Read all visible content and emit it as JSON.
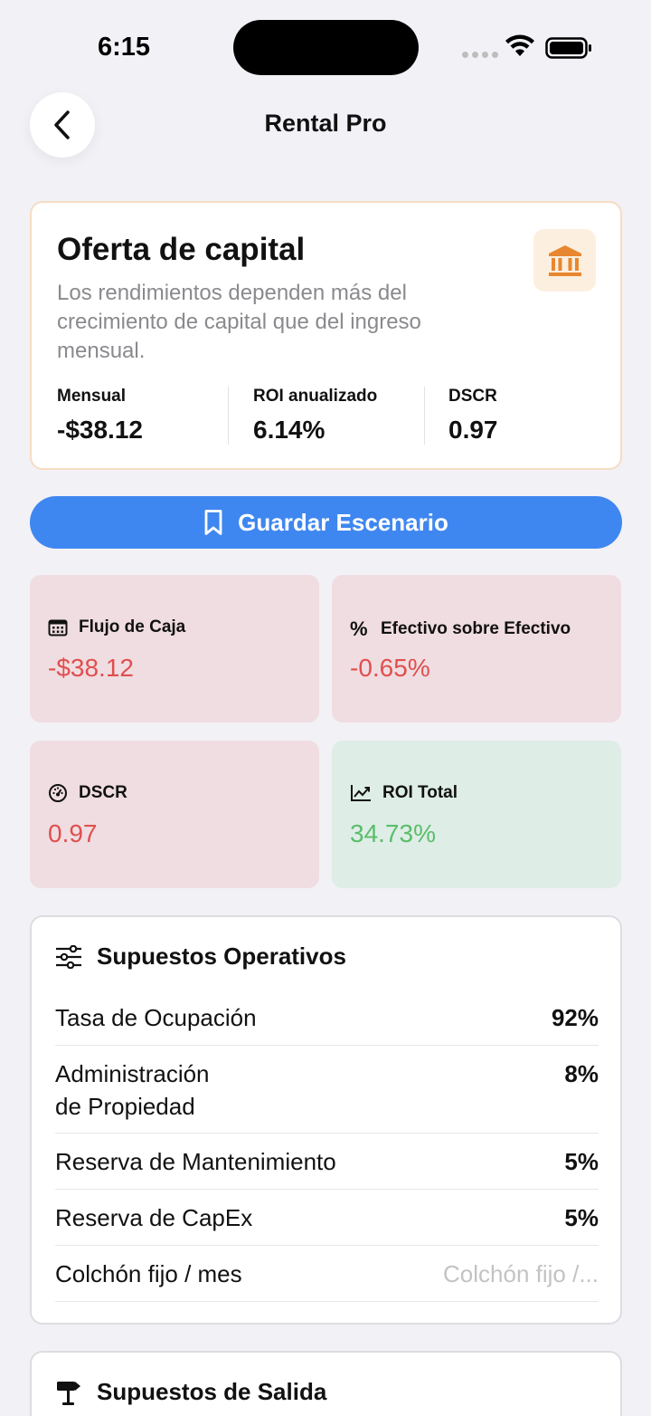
{
  "status_bar": {
    "time": "6:15"
  },
  "nav": {
    "title": "Rental Pro"
  },
  "offer": {
    "title": "Oferta de capital",
    "description": "Los rendimientos dependen más del crecimiento de capital que del ingreso mensual.",
    "icon": "bank-icon",
    "metrics": [
      {
        "label": "Mensual",
        "value": "-$38.12"
      },
      {
        "label": "ROI anualizado",
        "value": "6.14%"
      },
      {
        "label": "DSCR",
        "value": "0.97"
      }
    ]
  },
  "save_button": {
    "label": "Guardar Escenario",
    "icon": "bookmark-icon"
  },
  "tiles": [
    {
      "label": "Flujo de Caja",
      "value": "-$38.12",
      "icon": "calendar-icon",
      "status": "negative"
    },
    {
      "label": "Efectivo sobre Efectivo",
      "value": "-0.65%",
      "icon": "percent-icon",
      "status": "negative"
    },
    {
      "label": "DSCR",
      "value": "0.97",
      "icon": "gauge-icon",
      "status": "negative"
    },
    {
      "label": "ROI Total",
      "value": "34.73%",
      "icon": "trend-up-icon",
      "status": "positive"
    }
  ],
  "operating": {
    "title": "Supuestos Operativos",
    "icon": "sliders-icon",
    "rows": [
      {
        "label": "Tasa de Ocupación",
        "value": "92%"
      },
      {
        "label": "Administración de Propiedad",
        "label_line1": "Administración",
        "label_line2": "de Propiedad",
        "value": "8%"
      },
      {
        "label": "Reserva de Mantenimiento",
        "value": "5%"
      },
      {
        "label": "Reserva de CapEx",
        "value": "5%"
      },
      {
        "label": "Colchón fijo / mes",
        "placeholder": "Colchón fijo /..."
      }
    ]
  },
  "exit": {
    "title": "Supuestos de Salida",
    "icon": "signpost-icon"
  },
  "colors": {
    "background": "#f2f1f6",
    "accent": "#3f87f0",
    "negative": "#e04f4f",
    "positive": "#5abd6a",
    "negative_tile": "#f0dde1",
    "positive_tile": "#deede6",
    "offer_icon": "#e8872f"
  }
}
